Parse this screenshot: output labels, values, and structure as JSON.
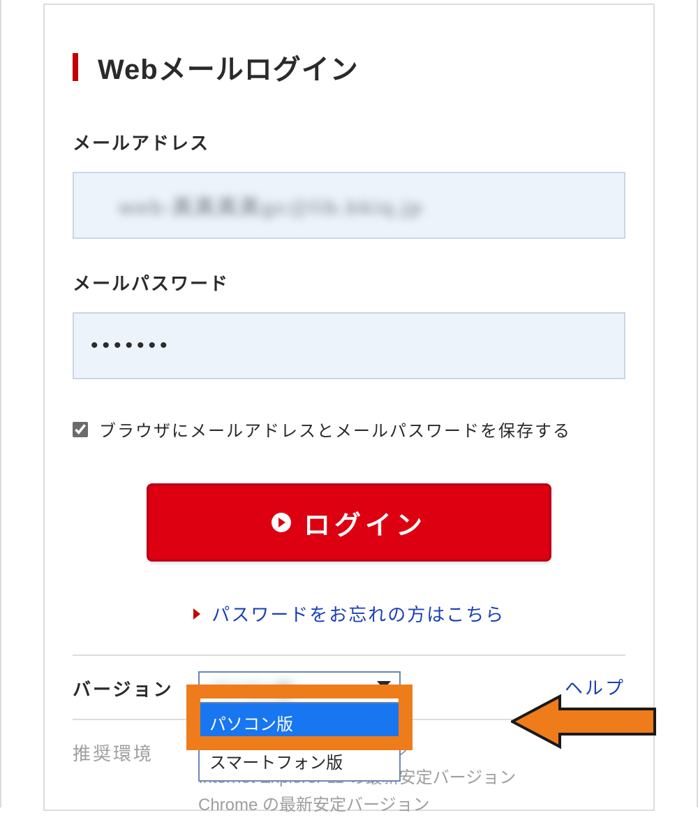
{
  "title": "Webメールログイン",
  "fields": {
    "email_label": "メールアドレス",
    "email_value_obscured": "web-真真真真gc@lib.bkiq.jp",
    "password_label": "メールパスワード",
    "password_value": "•••••••"
  },
  "save": {
    "checked": true,
    "label": "ブラウザにメールアドレスとメールパスワードを保存する"
  },
  "login_button_label": "ログイン",
  "forgot_label": "パスワードをお忘れの方はこちら",
  "version": {
    "label": "バージョン",
    "selected": "パソコン版",
    "options": [
      "パソコン版",
      "スマートフォン版"
    ]
  },
  "help_label": "ヘルプ",
  "env": {
    "label": "推奨環境",
    "items": [
      "Edge の最新安定バージョン",
      "Internet Explorer 11 の最新安定バージョン",
      "Chrome の最新安定バージョン"
    ]
  },
  "colors": {
    "accent_red": "#dc0010",
    "accent_orange": "#ef7c1a",
    "link_blue": "#1a3fb8"
  }
}
